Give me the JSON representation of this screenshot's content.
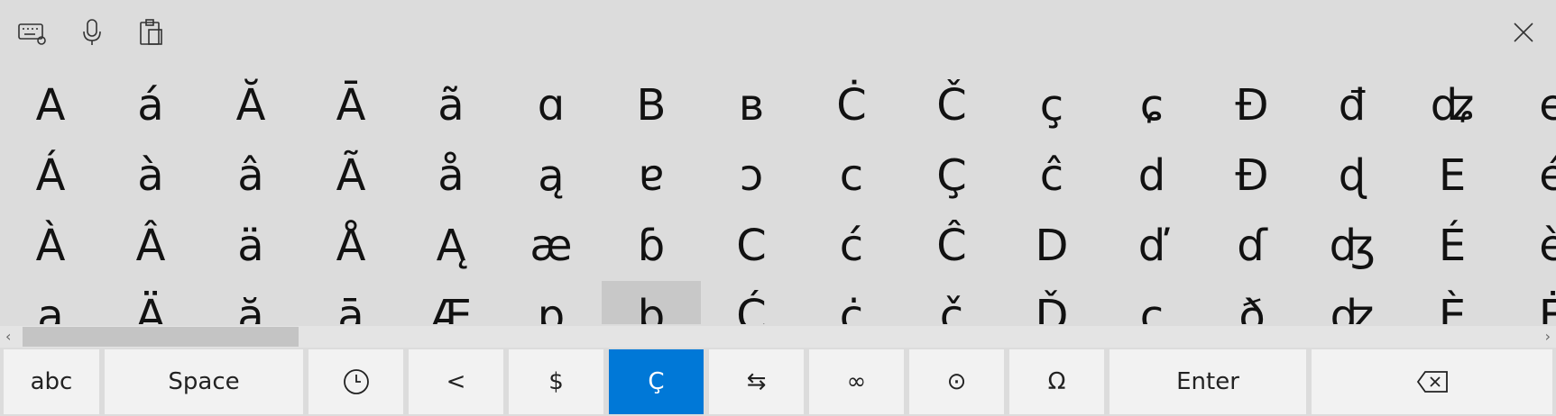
{
  "toolbar": {
    "icons": [
      "keyboard-settings-icon",
      "microphone-icon",
      "clipboard-icon",
      "close-icon"
    ]
  },
  "symbols": [
    [
      "A",
      "Á",
      "À",
      "a"
    ],
    [
      "á",
      "à",
      "Â",
      "Ä"
    ],
    [
      "Ă",
      "â",
      "ä",
      "ă"
    ],
    [
      "Ā",
      "Ã",
      "Å",
      "ā"
    ],
    [
      "ã",
      "å",
      "Ą",
      "Æ"
    ],
    [
      "ɑ",
      "ą",
      "æ",
      "ɒ"
    ],
    [
      "B",
      "ɐ",
      "ɓ",
      "b"
    ],
    [
      "в",
      "ɔ",
      "C",
      "Ć"
    ],
    [
      "Ċ",
      "c",
      "ć",
      "ċ"
    ],
    [
      "Č",
      "Ç",
      "Ĉ",
      "č"
    ],
    [
      "ç",
      "ĉ",
      "D",
      "Ď"
    ],
    [
      "ɕ",
      "d",
      "ď",
      "ç"
    ],
    [
      "Đ",
      "Ð",
      "ɗ",
      "ð"
    ],
    [
      "đ",
      "ɖ",
      "ʤ",
      "ʣ"
    ],
    [
      "ʥ",
      "E",
      "É",
      "È"
    ],
    [
      "e",
      "é",
      "è",
      "Ė"
    ]
  ],
  "selected_symbol": "b",
  "keys": {
    "abc": "abc",
    "space": "Space",
    "lt": "<",
    "dollar": "$",
    "latin": "Ç",
    "arrows": "⇆",
    "infinity": "∞",
    "circledot": "⊙",
    "omega": "Ω",
    "enter": "Enter"
  },
  "colors": {
    "accent": "#0078d7",
    "background": "#dcdcdc",
    "key": "#f2f2f2"
  }
}
